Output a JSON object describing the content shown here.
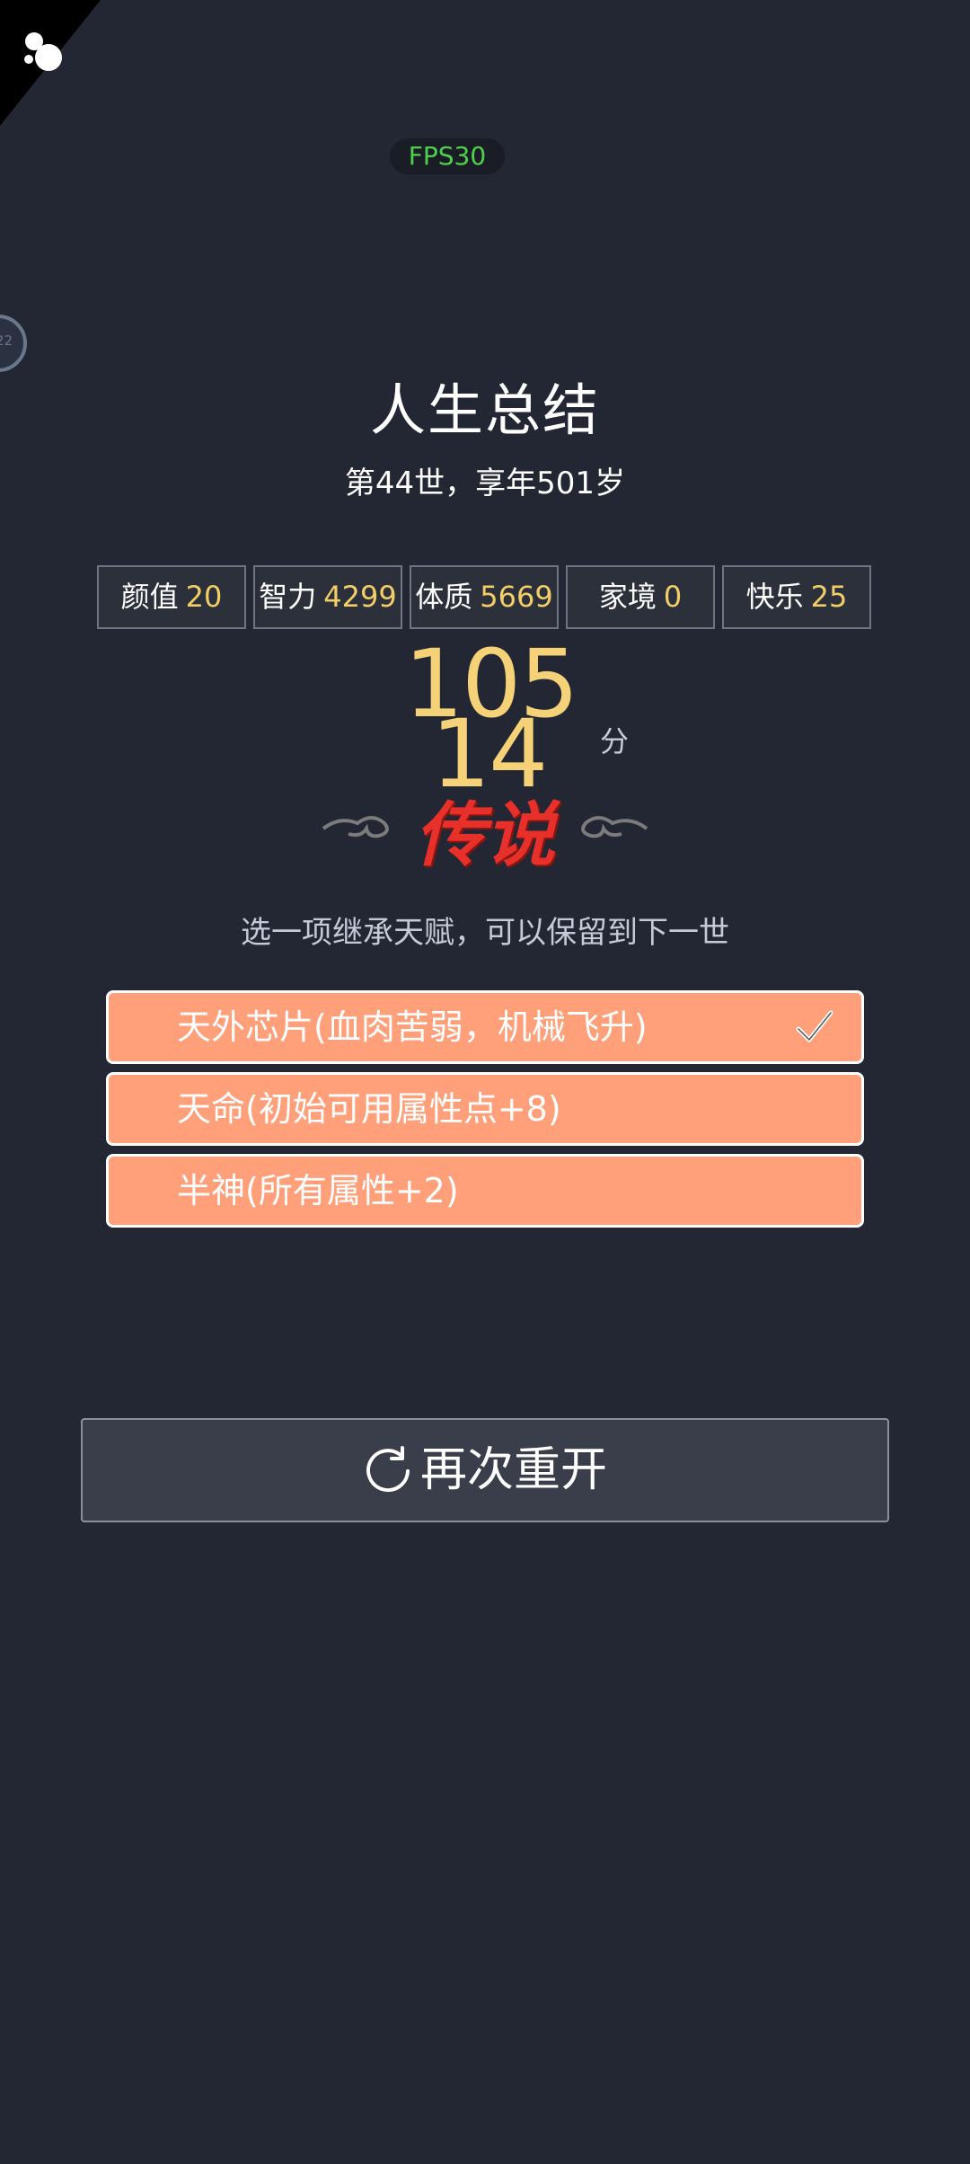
{
  "fps_label": "FPS30",
  "side_badge": "22",
  "summary": {
    "title": "人生总结",
    "subtitle": "第44世，享年501岁"
  },
  "stats": [
    {
      "label": "颜值",
      "value": "20"
    },
    {
      "label": "智力",
      "value": "4299"
    },
    {
      "label": "体质",
      "value": "5669"
    },
    {
      "label": "家境",
      "value": "0"
    },
    {
      "label": "快乐",
      "value": "25"
    }
  ],
  "score": {
    "line1": "105",
    "line2": "14",
    "unit": "分",
    "rank": "传说"
  },
  "talents": {
    "hint": "选一项继承天赋，可以保留到下一世",
    "items": [
      {
        "label": "天外芯片(血肉苦弱，机械飞升)",
        "selected": true
      },
      {
        "label": "天命(初始可用属性点+8)",
        "selected": false
      },
      {
        "label": "半神(所有属性+2)",
        "selected": false
      }
    ]
  },
  "restart_label": "再次重开",
  "colors": {
    "background": "#232733",
    "value_gold": "#f3cd68",
    "talent_bg": "#ffa07a",
    "rank_red": "#e8302a",
    "fps_green": "#4fd14f"
  }
}
